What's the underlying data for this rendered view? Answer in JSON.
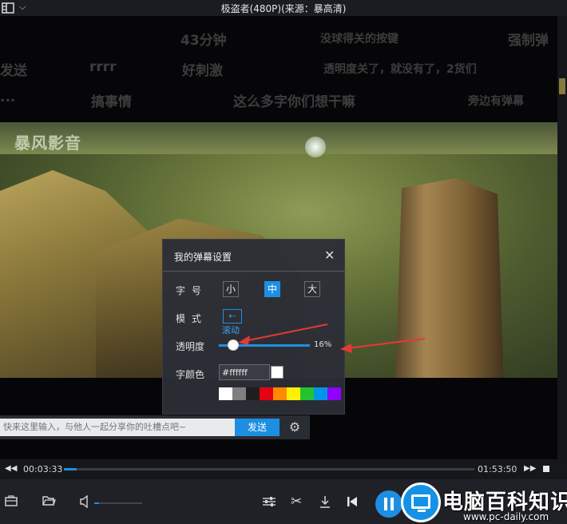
{
  "window": {
    "title": "极盗者(480P)(来源：暴高清)"
  },
  "video": {
    "watermark": "暴风影音"
  },
  "danmaku": [
    "43分钟",
    "没球得关的按键",
    "强制弹",
    "发送",
    "rrrr",
    "好刺激",
    "透明度关了，就没有了，2货们",
    "...",
    "搞事情",
    "这么多字你们想干嘛",
    "旁边有弹幕"
  ],
  "settings_panel": {
    "title": "我的弹幕设置",
    "font_size": {
      "label": "字 号",
      "options": [
        "小",
        "中",
        "大"
      ],
      "selected": "中"
    },
    "mode": {
      "label": "模 式",
      "option_label": "滚动"
    },
    "opacity": {
      "label": "透明度",
      "value": "16%",
      "fraction": 0.16
    },
    "font_color": {
      "label": "字颜色",
      "value": "#ffffff",
      "swatches": [
        "#ffffff",
        "#7f7f7f",
        "#1e1e1e",
        "#e60012",
        "#ff8a00",
        "#fff100",
        "#22c32e",
        "#0095e8",
        "#8f00ff"
      ]
    }
  },
  "comment": {
    "placeholder": "快来这里输入，与他人一起分享你的吐槽点吧~",
    "send_label": "发送"
  },
  "playback": {
    "current_time": "00:03:33",
    "total_time": "01:53:50",
    "progress_fraction": 0.031,
    "volume_fraction": 0.1
  },
  "logo": {
    "name": "电脑百科知识",
    "url": "www.pc-daily.com"
  },
  "colors": {
    "accent": "#1d8fe3",
    "annotation_arrow": "#e53935"
  }
}
